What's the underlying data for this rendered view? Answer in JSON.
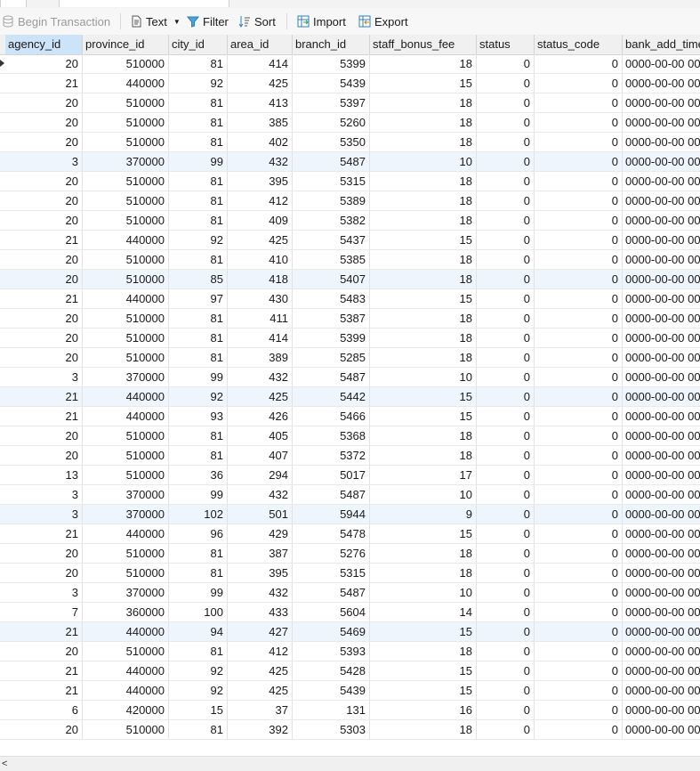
{
  "toolbar": {
    "begin_transaction": "Begin Transaction",
    "text": "Text",
    "filter": "Filter",
    "sort": "Sort",
    "import": "Import",
    "export": "Export"
  },
  "colors": {
    "header_bg": "#f0f0f0",
    "selected_header": "#cde3f8",
    "alt_row": "#eef5fd"
  },
  "columns": [
    "agency_id",
    "province_id",
    "city_id",
    "area_id",
    "branch_id",
    "staff_bonus_fee",
    "status",
    "status_code",
    "bank_add_time"
  ],
  "rows": [
    [
      "20",
      "510000",
      "81",
      "414",
      "5399",
      "18",
      "0",
      "0",
      "0000-00-00 00"
    ],
    [
      "21",
      "440000",
      "92",
      "425",
      "5439",
      "15",
      "0",
      "0",
      "0000-00-00 00"
    ],
    [
      "20",
      "510000",
      "81",
      "413",
      "5397",
      "18",
      "0",
      "0",
      "0000-00-00 00"
    ],
    [
      "20",
      "510000",
      "81",
      "385",
      "5260",
      "18",
      "0",
      "0",
      "0000-00-00 00"
    ],
    [
      "20",
      "510000",
      "81",
      "402",
      "5350",
      "18",
      "0",
      "0",
      "0000-00-00 00"
    ],
    [
      "3",
      "370000",
      "99",
      "432",
      "5487",
      "10",
      "0",
      "0",
      "0000-00-00 00"
    ],
    [
      "20",
      "510000",
      "81",
      "395",
      "5315",
      "18",
      "0",
      "0",
      "0000-00-00 00"
    ],
    [
      "20",
      "510000",
      "81",
      "412",
      "5389",
      "18",
      "0",
      "0",
      "0000-00-00 00"
    ],
    [
      "20",
      "510000",
      "81",
      "409",
      "5382",
      "18",
      "0",
      "0",
      "0000-00-00 00"
    ],
    [
      "21",
      "440000",
      "92",
      "425",
      "5437",
      "15",
      "0",
      "0",
      "0000-00-00 00"
    ],
    [
      "20",
      "510000",
      "81",
      "410",
      "5385",
      "18",
      "0",
      "0",
      "0000-00-00 00"
    ],
    [
      "20",
      "510000",
      "85",
      "418",
      "5407",
      "18",
      "0",
      "0",
      "0000-00-00 00"
    ],
    [
      "21",
      "440000",
      "97",
      "430",
      "5483",
      "15",
      "0",
      "0",
      "0000-00-00 00"
    ],
    [
      "20",
      "510000",
      "81",
      "411",
      "5387",
      "18",
      "0",
      "0",
      "0000-00-00 00"
    ],
    [
      "20",
      "510000",
      "81",
      "414",
      "5399",
      "18",
      "0",
      "0",
      "0000-00-00 00"
    ],
    [
      "20",
      "510000",
      "81",
      "389",
      "5285",
      "18",
      "0",
      "0",
      "0000-00-00 00"
    ],
    [
      "3",
      "370000",
      "99",
      "432",
      "5487",
      "10",
      "0",
      "0",
      "0000-00-00 00"
    ],
    [
      "21",
      "440000",
      "92",
      "425",
      "5442",
      "15",
      "0",
      "0",
      "0000-00-00 00"
    ],
    [
      "21",
      "440000",
      "93",
      "426",
      "5466",
      "15",
      "0",
      "0",
      "0000-00-00 00"
    ],
    [
      "20",
      "510000",
      "81",
      "405",
      "5368",
      "18",
      "0",
      "0",
      "0000-00-00 00"
    ],
    [
      "20",
      "510000",
      "81",
      "407",
      "5372",
      "18",
      "0",
      "0",
      "0000-00-00 00"
    ],
    [
      "13",
      "510000",
      "36",
      "294",
      "5017",
      "17",
      "0",
      "0",
      "0000-00-00 00"
    ],
    [
      "3",
      "370000",
      "99",
      "432",
      "5487",
      "10",
      "0",
      "0",
      "0000-00-00 00"
    ],
    [
      "3",
      "370000",
      "102",
      "501",
      "5944",
      "9",
      "0",
      "0",
      "0000-00-00 00"
    ],
    [
      "21",
      "440000",
      "96",
      "429",
      "5478",
      "15",
      "0",
      "0",
      "0000-00-00 00"
    ],
    [
      "20",
      "510000",
      "81",
      "387",
      "5276",
      "18",
      "0",
      "0",
      "0000-00-00 00"
    ],
    [
      "20",
      "510000",
      "81",
      "395",
      "5315",
      "18",
      "0",
      "0",
      "0000-00-00 00"
    ],
    [
      "3",
      "370000",
      "99",
      "432",
      "5487",
      "10",
      "0",
      "0",
      "0000-00-00 00"
    ],
    [
      "7",
      "360000",
      "100",
      "433",
      "5604",
      "14",
      "0",
      "0",
      "0000-00-00 00"
    ],
    [
      "21",
      "440000",
      "94",
      "427",
      "5469",
      "15",
      "0",
      "0",
      "0000-00-00 00"
    ],
    [
      "20",
      "510000",
      "81",
      "412",
      "5393",
      "18",
      "0",
      "0",
      "0000-00-00 00"
    ],
    [
      "21",
      "440000",
      "92",
      "425",
      "5428",
      "15",
      "0",
      "0",
      "0000-00-00 00"
    ],
    [
      "21",
      "440000",
      "92",
      "425",
      "5439",
      "15",
      "0",
      "0",
      "0000-00-00 00"
    ],
    [
      "6",
      "420000",
      "15",
      "37",
      "131",
      "16",
      "0",
      "0",
      "0000-00-00 00"
    ],
    [
      "20",
      "510000",
      "81",
      "392",
      "5303",
      "18",
      "0",
      "0",
      "0000-00-00 00"
    ]
  ],
  "scroll_left_glyph": "<"
}
